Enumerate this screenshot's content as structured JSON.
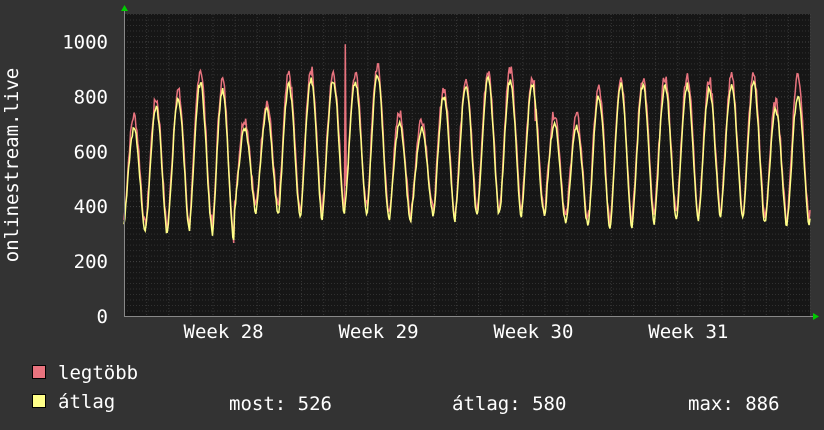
{
  "colors": {
    "background": "#333333",
    "plot_background": "#161616",
    "grid": "#444444",
    "text": "#ffffff",
    "series_max": "#e8737e",
    "series_avg": "#ffff88",
    "arrow": "#00cc00"
  },
  "chart_data": {
    "type": "line",
    "ylabel": "onlinestream.live",
    "ylim": [
      0,
      1100
    ],
    "yticks": [
      0,
      200,
      400,
      600,
      800,
      1000
    ],
    "xlim": [
      0,
      31
    ],
    "xticks": [
      {
        "x": 4.5,
        "label": "Week 28"
      },
      {
        "x": 11.5,
        "label": "Week 29"
      },
      {
        "x": 18.5,
        "label": "Week 30"
      },
      {
        "x": 25.5,
        "label": "Week 31"
      }
    ],
    "grid": true,
    "legend_position": "bottom-left",
    "series": [
      {
        "name": "legtöbb",
        "color": "#e8737e",
        "daily_peak": [
          730,
          790,
          820,
          900,
          860,
          720,
          780,
          880,
          900,
          890,
          880,
          910,
          740,
          720,
          830,
          870,
          890,
          900,
          870,
          740,
          730,
          830,
          870,
          870,
          870,
          880,
          860,
          870,
          880,
          780,
          880
        ],
        "daily_min": [
          330,
          320,
          330,
          350,
          280,
          400,
          400,
          380,
          370,
          400,
          400,
          380,
          360,
          390,
          370,
          380,
          390,
          380,
          400,
          360,
          350,
          340,
          340,
          360,
          370,
          370,
          380,
          380,
          360,
          350,
          360
        ],
        "spikes": [
          {
            "x": 10.0,
            "value": 990
          },
          {
            "x": 18.6,
            "value": 710
          }
        ]
      },
      {
        "name": "átlag",
        "color": "#ffff88",
        "daily_peak": [
          680,
          760,
          790,
          850,
          820,
          680,
          750,
          840,
          860,
          860,
          850,
          880,
          700,
          680,
          800,
          840,
          860,
          860,
          840,
          700,
          690,
          800,
          840,
          840,
          840,
          840,
          830,
          840,
          850,
          750,
          800
        ],
        "daily_min": [
          310,
          300,
          310,
          330,
          270,
          380,
          380,
          360,
          350,
          380,
          380,
          360,
          340,
          370,
          350,
          360,
          370,
          360,
          380,
          340,
          330,
          320,
          320,
          340,
          350,
          350,
          360,
          360,
          340,
          330,
          340
        ],
        "spikes": []
      }
    ]
  },
  "legend": [
    {
      "label": "legtöbb",
      "color": "#e8737e"
    },
    {
      "label": "átlag",
      "color": "#ffff88"
    }
  ],
  "stats": {
    "most": "most: 526",
    "atlag": "átlag: 580",
    "max": "max: 886"
  }
}
